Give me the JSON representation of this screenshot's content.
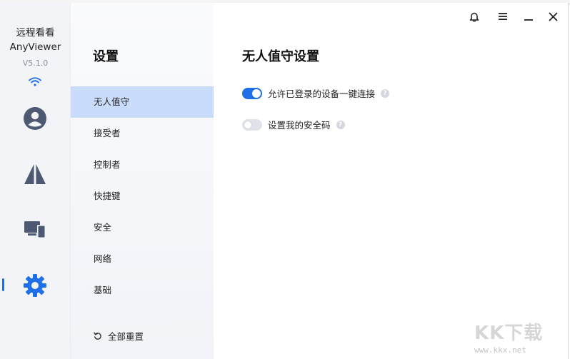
{
  "app": {
    "name_cn": "远程看看",
    "name_en": "AnyViewer",
    "version": "V5.1.0"
  },
  "colors": {
    "accent": "#1f6fe8",
    "active_nav_bg": "#c9dcfb",
    "rail_icon": "#4d5872"
  },
  "rail": {
    "items": [
      {
        "icon": "user-icon"
      },
      {
        "icon": "connect-icon"
      },
      {
        "icon": "devices-icon"
      },
      {
        "icon": "gear-icon",
        "active": true
      }
    ]
  },
  "nav": {
    "title": "设置",
    "items": [
      {
        "label": "无人值守",
        "active": true
      },
      {
        "label": "接受者"
      },
      {
        "label": "控制者"
      },
      {
        "label": "快捷键"
      },
      {
        "label": "安全"
      },
      {
        "label": "网络"
      },
      {
        "label": "基础"
      }
    ],
    "reset_label": "全部重置"
  },
  "main": {
    "title": "无人值守设置",
    "settings": [
      {
        "label": "允许已登录的设备一键连接",
        "enabled": true
      },
      {
        "label": "设置我的安全码",
        "enabled": false
      }
    ],
    "help_glyph": "?"
  },
  "watermark": {
    "logo": "KK下载",
    "url": "www.kkx.net"
  }
}
